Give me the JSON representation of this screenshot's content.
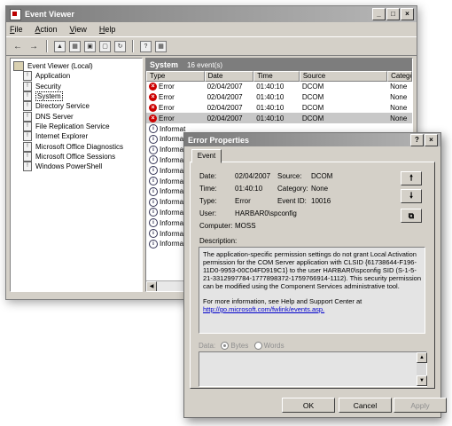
{
  "window": {
    "title": "Event Viewer",
    "controls": [
      "_",
      "□",
      "×"
    ]
  },
  "menu": [
    "File",
    "Action",
    "View",
    "Help"
  ],
  "tree": {
    "root": "Event Viewer (Local)",
    "items": [
      "Application",
      "Security",
      "System",
      "Directory Service",
      "DNS Server",
      "File Replication Service",
      "Internet Explorer",
      "Microsoft Office Diagnostics",
      "Microsoft Office Sessions",
      "Windows PowerShell"
    ],
    "selected": "System"
  },
  "list": {
    "title": "System",
    "count": "16 event(s)",
    "columns": [
      "Type",
      "Date",
      "Time",
      "Source",
      "Catego"
    ],
    "rows": [
      {
        "type": "Error",
        "date": "02/04/2007",
        "time": "01:40:10",
        "source": "DCOM",
        "category": "None"
      },
      {
        "type": "Error",
        "date": "02/04/2007",
        "time": "01:40:10",
        "source": "DCOM",
        "category": "None"
      },
      {
        "type": "Error",
        "date": "02/04/2007",
        "time": "01:40:10",
        "source": "DCOM",
        "category": "None"
      },
      {
        "type": "Error",
        "date": "02/04/2007",
        "time": "01:40:10",
        "source": "DCOM",
        "category": "None"
      },
      {
        "type": "Informat",
        "date": "",
        "time": "",
        "source": "",
        "category": ""
      },
      {
        "type": "Informat",
        "date": "",
        "time": "",
        "source": "",
        "category": ""
      },
      {
        "type": "Informat",
        "date": "",
        "time": "",
        "source": "",
        "category": ""
      },
      {
        "type": "Informat",
        "date": "",
        "time": "",
        "source": "",
        "category": ""
      },
      {
        "type": "Informat",
        "date": "",
        "time": "",
        "source": "",
        "category": ""
      },
      {
        "type": "Informat",
        "date": "",
        "time": "",
        "source": "",
        "category": ""
      },
      {
        "type": "Informat",
        "date": "",
        "time": "",
        "source": "",
        "category": ""
      },
      {
        "type": "Informat",
        "date": "",
        "time": "",
        "source": "",
        "category": ""
      },
      {
        "type": "Informat",
        "date": "",
        "time": "",
        "source": "",
        "category": ""
      },
      {
        "type": "Informat",
        "date": "",
        "time": "",
        "source": "",
        "category": ""
      },
      {
        "type": "Informat",
        "date": "",
        "time": "",
        "source": "",
        "category": ""
      },
      {
        "type": "Informat",
        "date": "",
        "time": "",
        "source": "",
        "category": ""
      }
    ],
    "selected_row": 3
  },
  "dialog": {
    "title": "Error Properties",
    "title_buttons": [
      "?",
      "×"
    ],
    "tab": "Event",
    "labels": {
      "date": "Date:",
      "time": "Time:",
      "type": "Type:",
      "user": "User:",
      "computer": "Computer:",
      "source": "Source:",
      "category": "Category:",
      "event_id": "Event ID:",
      "description": "Description:",
      "data": "Data:",
      "bytes": "Bytes",
      "words": "Words"
    },
    "values": {
      "date": "02/04/2007",
      "time": "01:40:10",
      "type": "Error",
      "user": "HARBAR0\\spconfig",
      "computer": "MOSS",
      "source": "DCOM",
      "category": "None",
      "event_id": "10016"
    },
    "description": {
      "text": "The application-specific permission settings do not grant Local Activation permission for the COM Server application with CLSID {61738644-F196-11D0-9953-00C04FD919C1} to the user HARBAR0\\spconfig SID (S-1-5-21-3312997784-1777898372-1759766914-1112). This security permission can be modified using the Component Services administrative tool.",
      "help_intro": "For more information, see Help and Support Center at",
      "link": "http://go.microsoft.com/fwlink/events.asp."
    },
    "buttons": {
      "ok": "OK",
      "cancel": "Cancel",
      "apply": "Apply"
    }
  }
}
